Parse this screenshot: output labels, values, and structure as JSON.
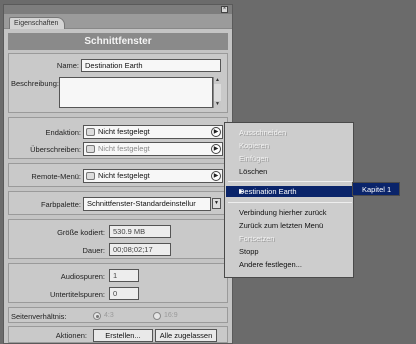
{
  "palette": {
    "tab_label": "Eigenschaften",
    "title": "Schnittfenster",
    "name_label": "Name:",
    "name_value": "Destination Earth",
    "description_label": "Beschreibung:",
    "end_action_label": "Endaktion:",
    "end_action_value": "Nicht festgelegt",
    "override_label": "Überschreiben:",
    "override_value": "Nicht festgelegt",
    "remote_menu_label": "Remote-Menü:",
    "remote_menu_value": "Nicht festgelegt",
    "color_palette_label": "Farbpalette:",
    "color_palette_value": "Schnittfenster-Standardeinstellur",
    "size_label": "Größe kodiert:",
    "size_value": "530.9 MB",
    "duration_label": "Dauer:",
    "duration_value": "00;08;02;17",
    "audio_tracks_label": "Audiospuren:",
    "audio_tracks_value": "1",
    "subtitle_tracks_label": "Untertitelspuren:",
    "subtitle_tracks_value": "0",
    "aspect_label": "Seitenverhältnis:",
    "aspect_opt1": "4:3",
    "aspect_opt2": "16:9",
    "actions_label": "Aktionen:",
    "create_button": "Erstellen...",
    "allow_all_button": "Alle zugelassen"
  },
  "context_menu": {
    "items_top": [
      "Ausschneiden",
      "Kopieren",
      "Einfügen",
      "Löschen"
    ],
    "items_top_disabled": [
      true,
      true,
      true,
      false
    ],
    "highlighted": "Destination Earth",
    "items_bottom": [
      "Verbindung hierher zurück",
      "Zurück zum letzten Menü",
      "Fortsetzen",
      "Stopp",
      "Andere festlegen..."
    ],
    "items_bottom_disabled": [
      false,
      false,
      true,
      false,
      false
    ]
  },
  "submenu": {
    "item": "Kapitel 1"
  },
  "colors": {
    "background": "#6b6b6b",
    "panel": "#c4c4c4",
    "highlight": "#0a246a"
  }
}
